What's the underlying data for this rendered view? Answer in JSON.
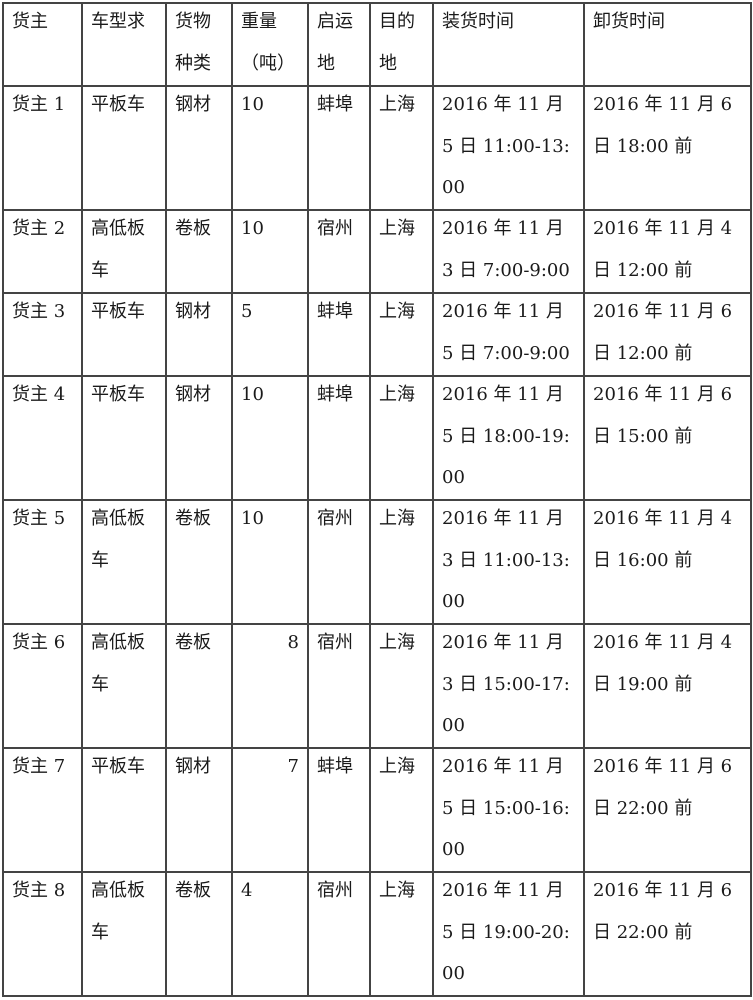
{
  "table": {
    "headers": [
      "货主",
      "车型求",
      "货物种类",
      "重量（吨）",
      "启运地",
      "目的地",
      "装货时间",
      "卸货时间"
    ],
    "rows": [
      {
        "shipper": "货主 1",
        "vehicle_type": "平板车",
        "cargo_type": "钢材",
        "weight": "10",
        "origin": "蚌埠",
        "destination": "上海",
        "loading_time": "2016 年 11 月 5 日 11:00-13:00",
        "unloading_time": "2016 年 11 月 6 日 18:00 前"
      },
      {
        "shipper": "货主 2",
        "vehicle_type": "高低板车",
        "cargo_type": "卷板",
        "weight": "10",
        "origin": "宿州",
        "destination": "上海",
        "loading_time": "2016 年 11 月 3 日 7:00-9:00",
        "unloading_time": "2016 年 11 月 4 日 12:00 前"
      },
      {
        "shipper": "货主 3",
        "vehicle_type": "平板车",
        "cargo_type": "钢材",
        "weight": "5",
        "origin": "蚌埠",
        "destination": "上海",
        "loading_time": "2016 年 11 月 5 日 7:00-9:00",
        "unloading_time": "2016 年 11 月 6 日 12:00 前"
      },
      {
        "shipper": "货主 4",
        "vehicle_type": "平板车",
        "cargo_type": "钢材",
        "weight": "10",
        "origin": "蚌埠",
        "destination": "上海",
        "loading_time": "2016 年 11 月 5 日 18:00-19:00",
        "unloading_time": "2016 年 11 月 6 日 15:00 前"
      },
      {
        "shipper": "货主 5",
        "vehicle_type": "高低板车",
        "cargo_type": "卷板",
        "weight": "10",
        "origin": "宿州",
        "destination": "上海",
        "loading_time": "2016 年 11 月 3 日 11:00-13:00",
        "unloading_time": "2016 年 11 月 4 日 16:00 前"
      },
      {
        "shipper": "货主 6",
        "vehicle_type": "高低板车",
        "cargo_type": "卷板",
        "weight": "8",
        "origin": "宿州",
        "destination": "上海",
        "loading_time": "2016 年 11 月 3 日 15:00-17:00",
        "unloading_time": "2016 年 11 月 4 日 19:00 前"
      },
      {
        "shipper": "货主 7",
        "vehicle_type": "平板车",
        "cargo_type": "钢材",
        "weight": "7",
        "origin": "蚌埠",
        "destination": "上海",
        "loading_time": "2016 年 11 月 5 日 15:00-16:00",
        "unloading_time": "2016 年 11 月 6 日 22:00 前"
      },
      {
        "shipper": "货主 8",
        "vehicle_type": "高低板车",
        "cargo_type": "卷板",
        "weight": "4",
        "origin": "宿州",
        "destination": "上海",
        "loading_time": "2016 年 11 月 5 日 19:00-20:00",
        "unloading_time": "2016 年 11 月 6 日 22:00 前"
      }
    ]
  }
}
